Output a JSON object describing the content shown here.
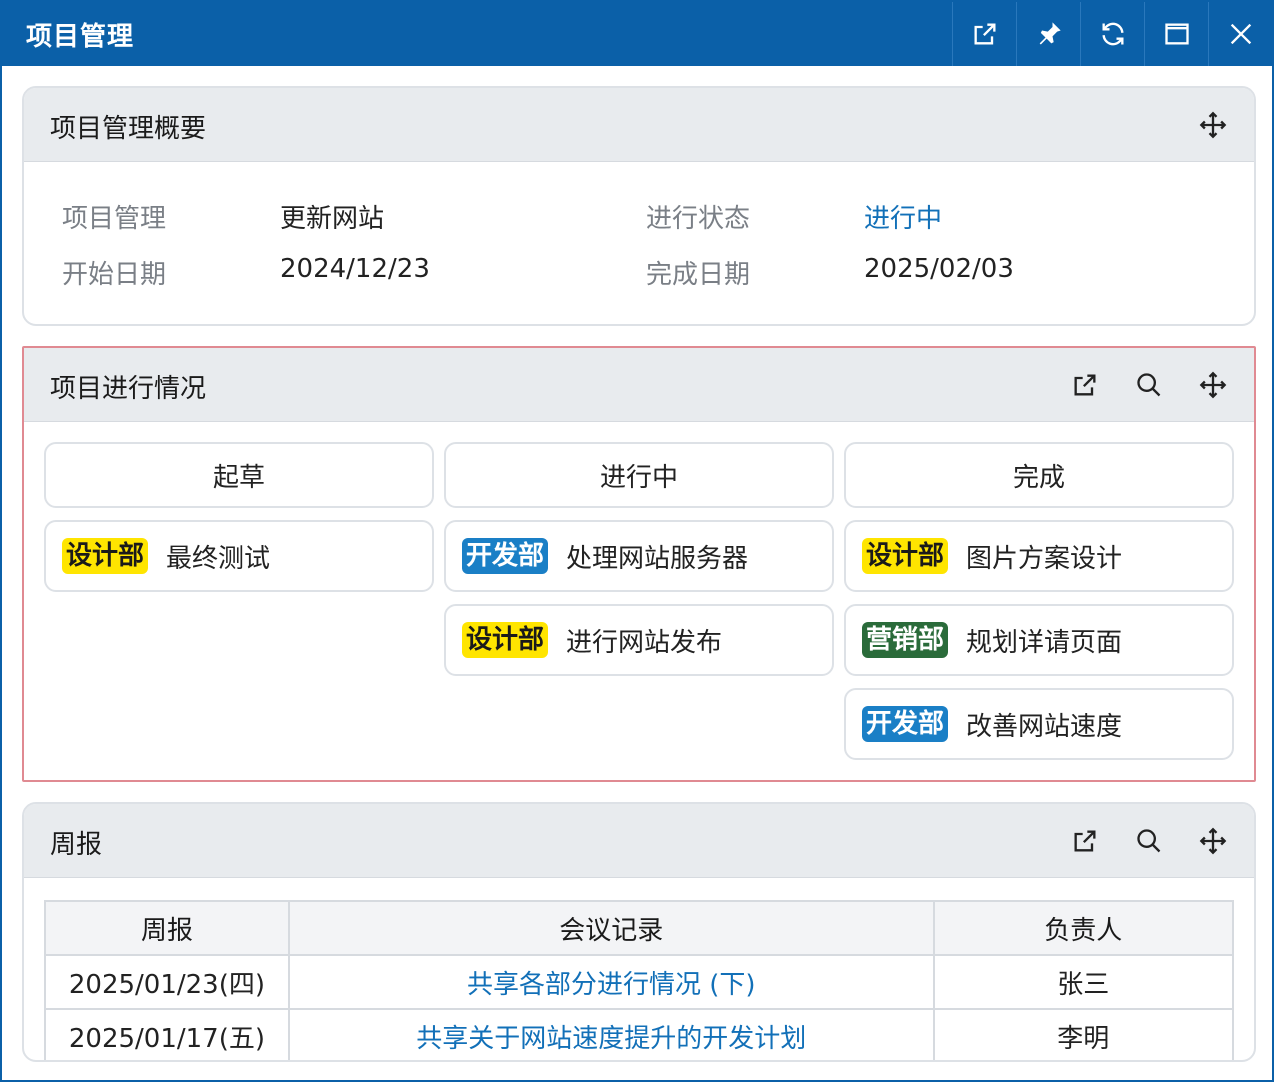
{
  "window": {
    "title": "项目管理",
    "buttons": [
      "external-link-icon",
      "pin-icon",
      "refresh-icon",
      "maximize-icon",
      "close-icon"
    ]
  },
  "overview": {
    "title": "项目管理概要",
    "fields": {
      "project_label": "项目管理",
      "project_value": "更新网站",
      "status_label": "进行状态",
      "status_value": "进行中",
      "start_label": "开始日期",
      "start_value": "2024/12/23",
      "end_label": "完成日期",
      "end_value": "2025/02/03"
    }
  },
  "progress": {
    "title": "项目进行情况",
    "columns": [
      {
        "label": "起草",
        "cards": [
          {
            "dept": "设计部",
            "task": "最终测试"
          }
        ]
      },
      {
        "label": "进行中",
        "cards": [
          {
            "dept": "开发部",
            "task": "处理网站服务器"
          },
          {
            "dept": "设计部",
            "task": "进行网站发布"
          }
        ]
      },
      {
        "label": "完成",
        "cards": [
          {
            "dept": "设计部",
            "task": "图片方案设计"
          },
          {
            "dept": "营销部",
            "task": "规划详请页面"
          },
          {
            "dept": "开发部",
            "task": "改善网站速度"
          }
        ]
      }
    ]
  },
  "weekly": {
    "title": "周报",
    "headers": [
      "周报",
      "会议记录",
      "负责人"
    ],
    "rows": [
      {
        "date": "2025/01/23(四)",
        "note": "共享各部分进行情况 (下)",
        "owner": "张三"
      },
      {
        "date": "2025/01/17(五)",
        "note": "共享关于网站速度提升的开发计划",
        "owner": "李明"
      }
    ]
  },
  "colors": {
    "titlebar": "#0b60a8",
    "design_badge": "#ffe500",
    "dev_badge": "#1a7fc6",
    "marketing_badge": "#2a6b3a",
    "link": "#1270b8",
    "highlight_border": "#e08a92"
  }
}
